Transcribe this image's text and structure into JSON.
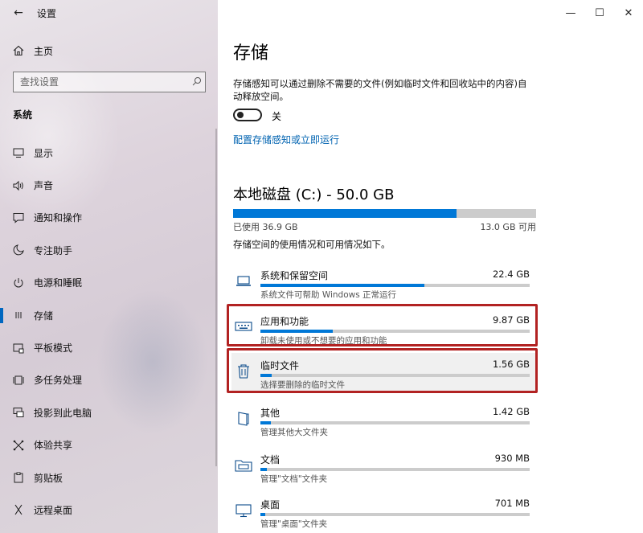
{
  "window": {
    "title": "设置",
    "back_icon": "←",
    "minimize": "—",
    "maximize": "☐",
    "close": "✕"
  },
  "sidebar": {
    "home_label": "主页",
    "search_placeholder": "查找设置",
    "section": "系统",
    "items": [
      {
        "label": "显示",
        "icon": "monitor-icon"
      },
      {
        "label": "声音",
        "icon": "speaker-icon"
      },
      {
        "label": "通知和操作",
        "icon": "notification-icon"
      },
      {
        "label": "专注助手",
        "icon": "moon-icon"
      },
      {
        "label": "电源和睡眠",
        "icon": "power-icon"
      },
      {
        "label": "存储",
        "icon": "storage-icon",
        "active": true
      },
      {
        "label": "平板模式",
        "icon": "tablet-icon"
      },
      {
        "label": "多任务处理",
        "icon": "multitask-icon"
      },
      {
        "label": "投影到此电脑",
        "icon": "project-icon"
      },
      {
        "label": "体验共享",
        "icon": "share-icon"
      },
      {
        "label": "剪贴板",
        "icon": "clipboard-icon"
      },
      {
        "label": "远程桌面",
        "icon": "remote-icon"
      }
    ]
  },
  "main": {
    "title": "存储",
    "sense_desc": "存储感知可以通过删除不需要的文件(例如临时文件和回收站中的内容)自动释放空间。",
    "toggle_state": "关",
    "toggle_on": false,
    "config_link": "配置存储感知或立即运行",
    "disk_title": "本地磁盘 (C:) - 50.0 GB",
    "used": "已使用 36.9 GB",
    "free": "13.0 GB 可用",
    "used_fraction": 0.738,
    "usage_desc": "存储空间的使用情况和可用情况如下。",
    "categories": [
      {
        "name": "系统和保留空间",
        "size": "22.4 GB",
        "sub": "系统文件可帮助 Windows 正常运行",
        "fraction": 0.608,
        "icon": "laptop-icon"
      },
      {
        "name": "应用和功能",
        "size": "9.87 GB",
        "sub": "卸载未使用或不想要的应用和功能",
        "fraction": 0.268,
        "icon": "keyboard-icon"
      },
      {
        "name": "临时文件",
        "size": "1.56 GB",
        "sub": "选择要删除的临时文件",
        "fraction": 0.042,
        "icon": "trash-icon"
      },
      {
        "name": "其他",
        "size": "1.42 GB",
        "sub": "管理其他大文件夹",
        "fraction": 0.038,
        "icon": "folder-open-icon"
      },
      {
        "name": "文档",
        "size": "930 MB",
        "sub": "管理\"文档\"文件夹",
        "fraction": 0.025,
        "icon": "folder-icon"
      },
      {
        "name": "桌面",
        "size": "701 MB",
        "sub": "管理\"桌面\"文件夹",
        "fraction": 0.019,
        "icon": "desktop-icon"
      }
    ]
  },
  "colors": {
    "accent": "#0078d7",
    "link": "#0063b1",
    "highlight_box": "#b22222"
  }
}
